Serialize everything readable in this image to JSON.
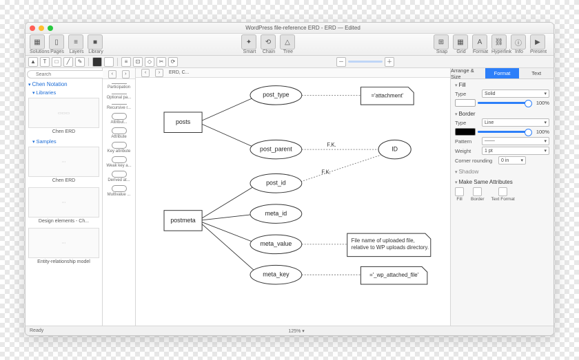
{
  "window": {
    "title": "WordPress file-reference ERD - ERD — Edited"
  },
  "toolbar": {
    "items_left": [
      {
        "icon": "▦",
        "label": "Solutions"
      },
      {
        "icon": "▯",
        "label": "Pages"
      },
      {
        "icon": "≡",
        "label": "Layers"
      },
      {
        "icon": "■",
        "label": "Library"
      }
    ],
    "items_mid": [
      {
        "icon": "✦",
        "label": "Smart"
      },
      {
        "icon": "⟲",
        "label": "Chain"
      },
      {
        "icon": "△",
        "label": "Tree"
      }
    ],
    "items_right": [
      {
        "icon": "⊞",
        "label": "Snap"
      },
      {
        "icon": "▦",
        "label": "Grid"
      },
      {
        "icon": "A",
        "label": "Format"
      },
      {
        "icon": "⛓",
        "label": "Hyperlink"
      },
      {
        "icon": "ⓘ",
        "label": "Info"
      },
      {
        "icon": "▶",
        "label": "Present"
      }
    ]
  },
  "breadcrumb": {
    "item": "ERD, C..."
  },
  "lib": {
    "search_ph": "Search",
    "chen": "Chen Notation",
    "libs": "Libraries",
    "samples": "Samples",
    "thumbs": [
      "Chen ERD",
      "Chen ERD",
      "Design elements - Ch...",
      "Entity-relationship model"
    ]
  },
  "stencils": [
    "Participation",
    "Optional pa...",
    "Recursive r...",
    "Attribut...",
    "Attribute",
    "Key attribute",
    "Weak key a...",
    "Derived at...",
    "Multivalue ..."
  ],
  "diagram": {
    "entities": [
      "posts",
      "postmeta"
    ],
    "attrs": [
      "post_type",
      "post_parent",
      "ID",
      "post_id",
      "meta_id",
      "meta_value",
      "meta_key"
    ],
    "notes": [
      "='attachment'",
      "File name of uploaded file,\nrelative to WP uploads directory.",
      "='_wp_attached_file'"
    ],
    "fk": "F.K."
  },
  "inspector": {
    "tabs": [
      "Arrange & Size",
      "Format",
      "Text"
    ],
    "fill": {
      "h": "Fill",
      "type": "Type",
      "type_v": "Solid",
      "opacity": "100%"
    },
    "border": {
      "h": "Border",
      "type": "Type",
      "type_v": "Line",
      "pattern": "Pattern",
      "opacity": "100%",
      "weight": "Weight",
      "weight_v": "1 pt",
      "corner": "Corner rounding",
      "corner_v": "0 in"
    },
    "shadow": "Shadow",
    "msa": {
      "h": "Make Same Attributes",
      "opts": [
        "Fill",
        "Border",
        "Text Format"
      ]
    }
  },
  "footer": {
    "status": "Ready",
    "zoom": "125%"
  }
}
